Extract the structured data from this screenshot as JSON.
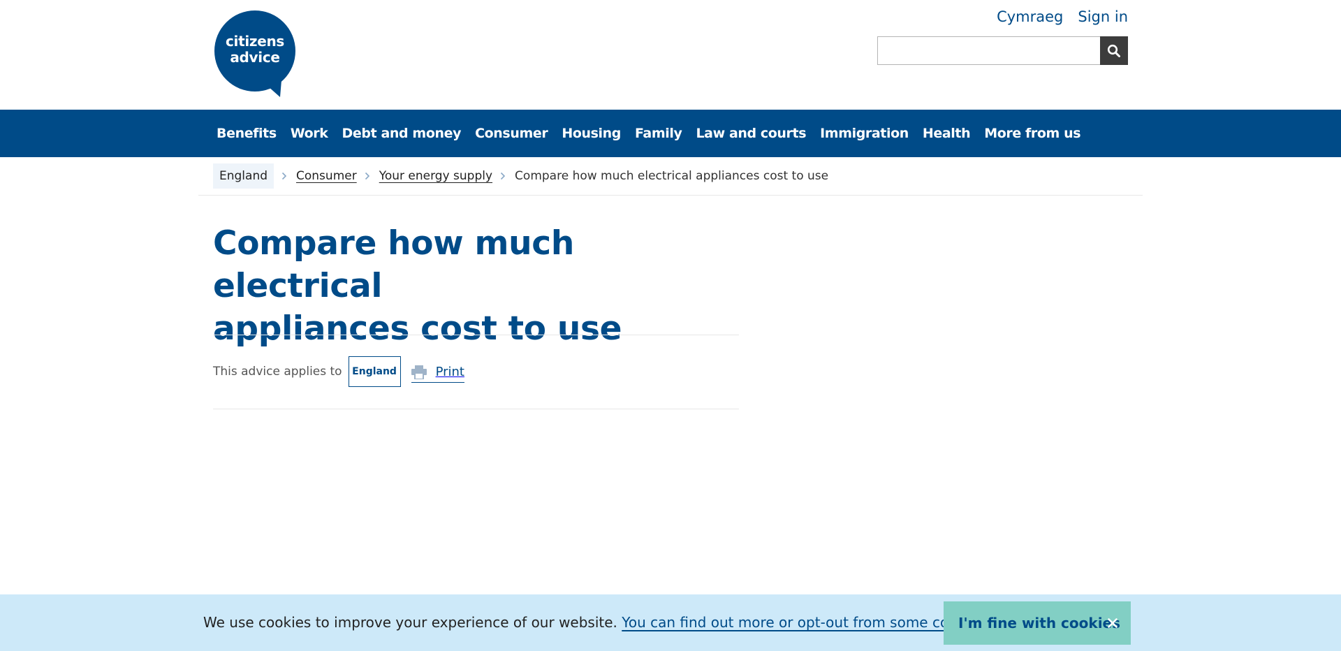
{
  "header": {
    "logo": {
      "line1": "citizens",
      "line2": "advice"
    },
    "top_links": [
      "Cymraeg",
      "Sign in"
    ],
    "search": {
      "placeholder": "",
      "value": "",
      "icon": "search-icon"
    }
  },
  "nav": {
    "items": [
      "Benefits",
      "Work",
      "Debt and money",
      "Consumer",
      "Housing",
      "Family",
      "Law and courts",
      "Immigration",
      "Health",
      "More from us"
    ]
  },
  "breadcrumb": {
    "country": "England",
    "links": [
      "Consumer",
      "Your energy supply"
    ],
    "current": "Compare how much electrical appliances cost to use"
  },
  "page": {
    "title_line1": "Compare how much electrical",
    "title_line2": "appliances cost to use",
    "applies_label": "This advice applies to",
    "applies_country": "England",
    "print_label": "Print"
  },
  "cookie": {
    "text": "We use cookies to improve your experience of our website.",
    "link": "You can find out more or opt-out from some cookies",
    "suffix": ".",
    "button": "I'm fine with cookies"
  },
  "colors": {
    "brand": "#004b88",
    "cookie_bg": "#cde9f9",
    "cookie_button": "#82cfc4",
    "search_button": "#3c3c3c"
  }
}
